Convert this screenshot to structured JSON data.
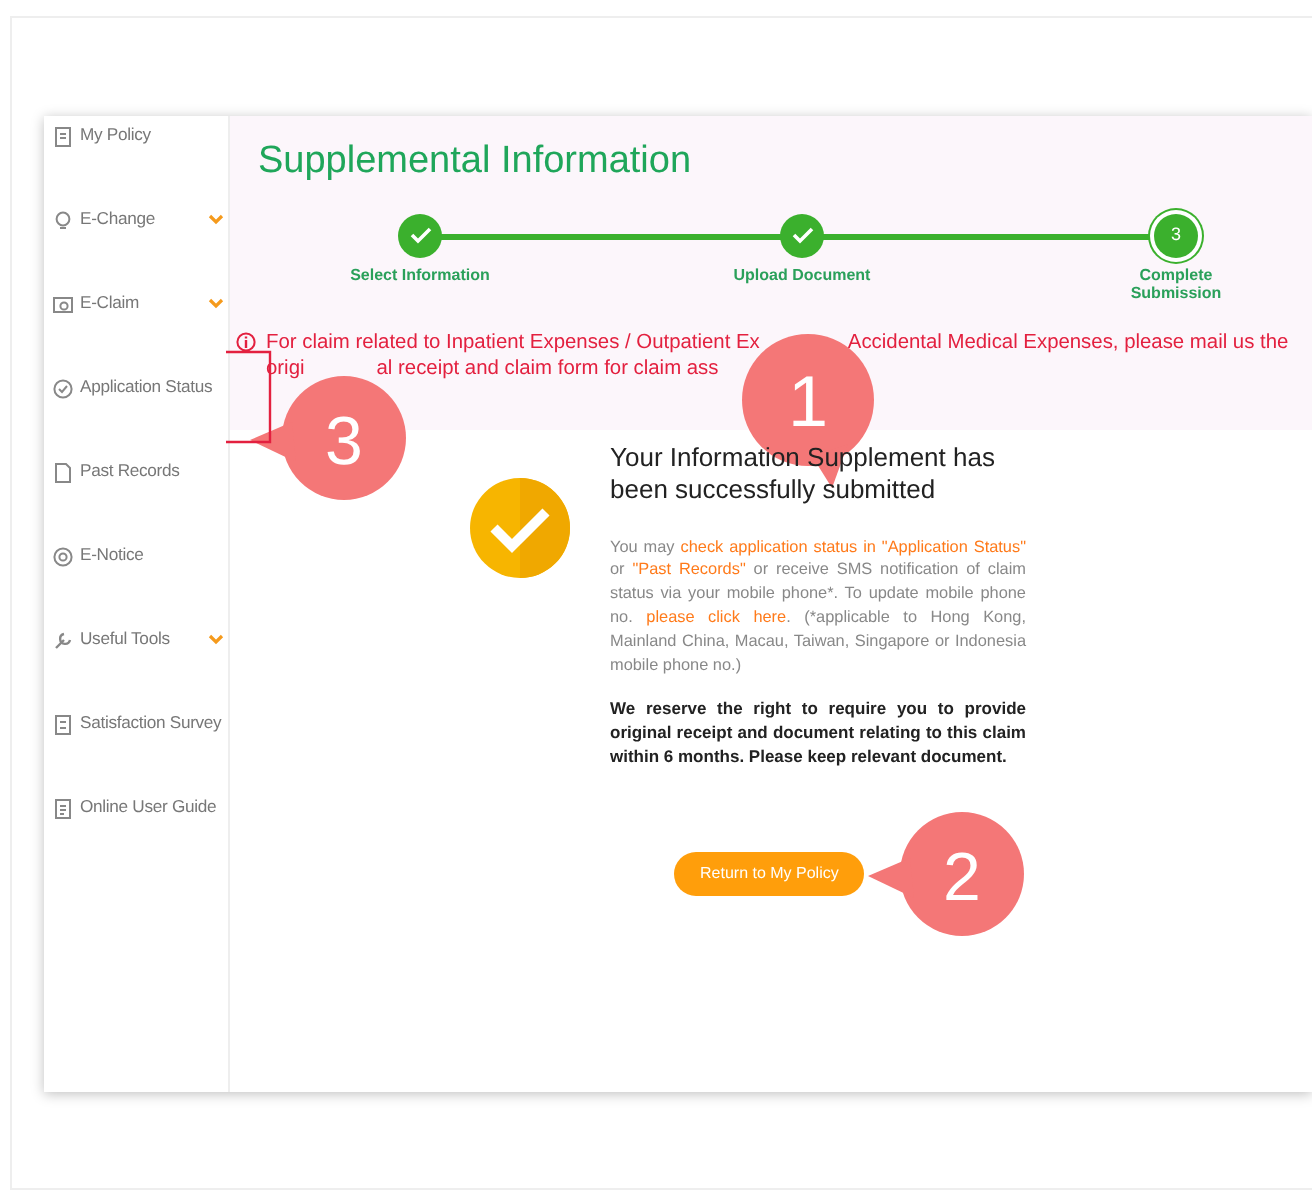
{
  "sidebar": {
    "items": [
      {
        "label": "My Policy",
        "has_submenu": false
      },
      {
        "label": "E-Change",
        "has_submenu": true
      },
      {
        "label": "E-Claim",
        "has_submenu": true
      },
      {
        "label": "Application Status",
        "has_submenu": false
      },
      {
        "label": "Past Records",
        "has_submenu": false
      },
      {
        "label": "E-Notice",
        "has_submenu": false
      },
      {
        "label": "Useful Tools",
        "has_submenu": true
      },
      {
        "label": "Satisfaction Survey",
        "has_submenu": false
      },
      {
        "label": "Online User Guide",
        "has_submenu": false
      }
    ]
  },
  "header": {
    "title": "Supplemental Information",
    "steps": [
      {
        "label": "Select Information",
        "completed": true
      },
      {
        "label": "Upload Document",
        "completed": true
      },
      {
        "label": "Complete Submission",
        "completed": false,
        "number": "3"
      }
    ]
  },
  "notice": {
    "lines": [
      [
        "For claim related to Inpatient Expenses / Outpatient Ex",
        "Accidental Medical Expenses, please mail us the"
      ],
      [
        "origi",
        "al receipt and claim form for claim ass"
      ]
    ]
  },
  "result": {
    "heading": "Your Information Supplement has been successfully submitted",
    "info": [
      {
        "text": "You may ",
        "link": false
      },
      {
        "text": "check application status in \"Application Status\"",
        "link": true
      },
      {
        "text": " or ",
        "link": false
      },
      {
        "text": "\"Past Records\"",
        "link": true
      },
      {
        "text": " or receive SMS notification of claim status via your mobile phone*. To update mobile phone no. ",
        "link": false
      },
      {
        "text": "please click here",
        "link": true
      },
      {
        "text": ". (*applicable to Hong Kong, Mainland China, Macau, Taiwan, Singapore or Indonesia mobile phone no.)",
        "link": false
      }
    ],
    "reserve": "We reserve the right to require you to provide original receipt and document relating to this claim within 6 months. Please keep relevant document.",
    "button": "Return to My Policy"
  },
  "callouts": [
    {
      "number": "1"
    },
    {
      "number": "2"
    },
    {
      "number": "3"
    }
  ]
}
